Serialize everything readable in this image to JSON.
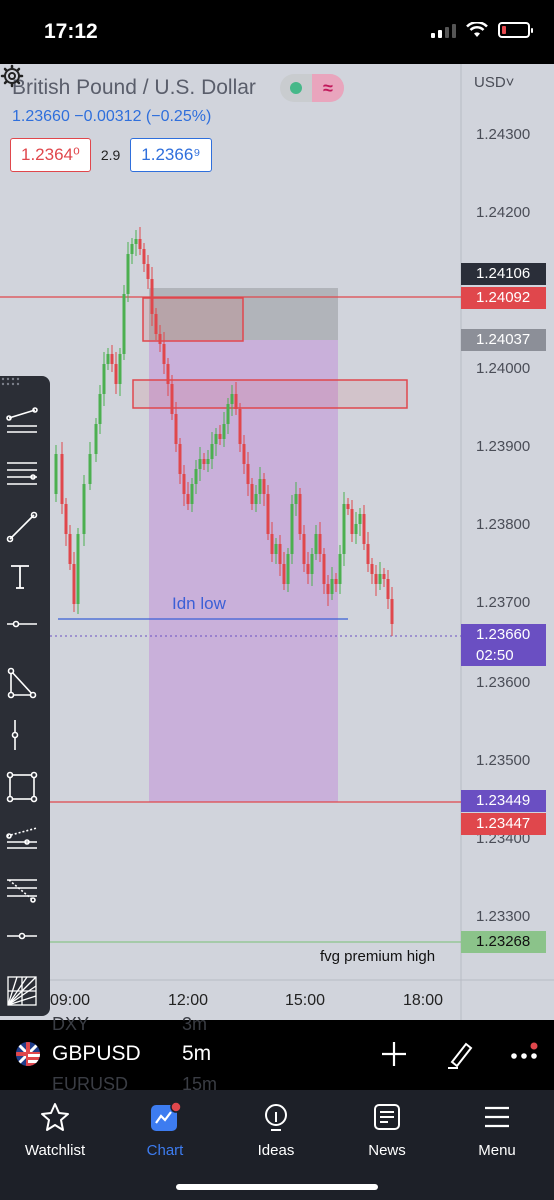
{
  "status_bar": {
    "time": "17:12"
  },
  "header": {
    "symbol_title": "British Pound / U.S. Dollar",
    "price_change": "1.23660 −0.00312 (−0.25%)",
    "bid": "1.2364⁰",
    "spread": "2.9",
    "ask": "1.2366⁹",
    "currency": "USD˅"
  },
  "price_axis": {
    "ticks": [
      "1.24300",
      "1.24200",
      "1.24000",
      "1.23900",
      "1.23800",
      "1.23700",
      "1.23600",
      "1.23500",
      "1.23400",
      "1.23300"
    ],
    "tags": {
      "t1": "1.24106",
      "t2": "1.24092",
      "t3": "1.24037",
      "last_price": "1.23660",
      "countdown": "02:50",
      "t4": "1.23449",
      "t5": "1.23447",
      "t6": "1.23268"
    }
  },
  "time_axis": [
    "09:00",
    "12:00",
    "15:00",
    "18:00"
  ],
  "annotations": {
    "idn_low": "Idn low",
    "fvg": "fvg premium high"
  },
  "colors": {
    "bull": "#4caf50",
    "bear": "#e0474c",
    "chart_bg": "#d1d4dc",
    "accent_blue": "#3d7cf0",
    "purple_tag": "#6a4fc2"
  },
  "drawing_tools": [
    "trend-lines-icon",
    "fib-tools-icon",
    "line-icon",
    "text-icon",
    "horizontal-line-icon",
    "triangle-pattern-icon",
    "vertical-ray-icon",
    "rectangle-icon",
    "prediction-icon",
    "projection-icon",
    "horizontal-ray-icon",
    "gann-icon"
  ],
  "symbol_bar": {
    "symbol": "GBPUSD",
    "timeframe": "5m",
    "ghost_above": {
      "symbol": "DXY",
      "timeframe": "3m"
    },
    "ghost_below": {
      "symbol": "EURUSD",
      "timeframe": "15m"
    }
  },
  "tabs": [
    {
      "label": "Watchlist",
      "icon": "star-icon"
    },
    {
      "label": "Chart",
      "icon": "chart-icon"
    },
    {
      "label": "Ideas",
      "icon": "lightbulb-icon"
    },
    {
      "label": "News",
      "icon": "news-icon"
    },
    {
      "label": "Menu",
      "icon": "menu-icon"
    }
  ]
}
